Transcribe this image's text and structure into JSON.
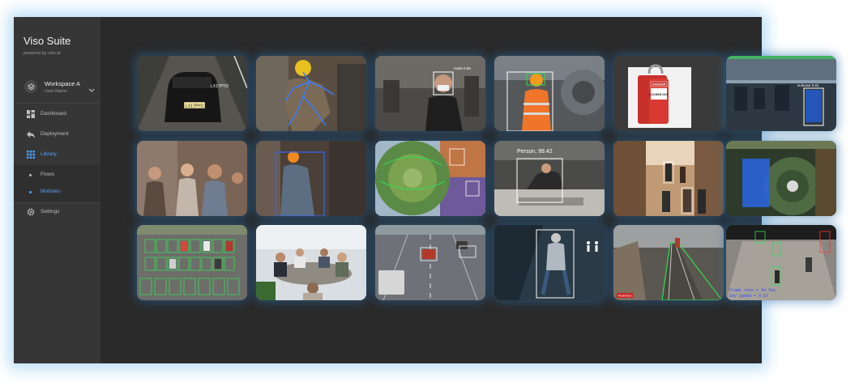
{
  "sidebar": {
    "brand": {
      "title": "Viso Suite",
      "subtitle": "powered by viso.ai"
    },
    "workspace": {
      "name": "Workspace A",
      "user": "User Name"
    },
    "nav": {
      "dashboard": "Dashboard",
      "deployment": "Deployment",
      "library": "Library",
      "flows": "Flows",
      "modules": "Modules",
      "settings": "Settings"
    }
  },
  "tiles": {
    "plate": "LX17PYD",
    "mask_label": "mask 0.89",
    "danger_sign": "DANGER",
    "locked_out": "LOCKED OUT",
    "luggage_label": "suitcase 0.91",
    "person_label": "Person, 99.42",
    "restricted": "Restricted",
    "frame_rate": "Frame rate = 54 fps",
    "env_speed": "Env Speed = 0.57"
  },
  "colors": {
    "accent": "#4da3ff",
    "sidebar_bg": "#363636",
    "content_bg": "#2a2a2a",
    "detection_box": "#ffffff",
    "detection_green": "#33dd55",
    "detection_blue": "#3366ff",
    "detection_red": "#ff3333"
  }
}
